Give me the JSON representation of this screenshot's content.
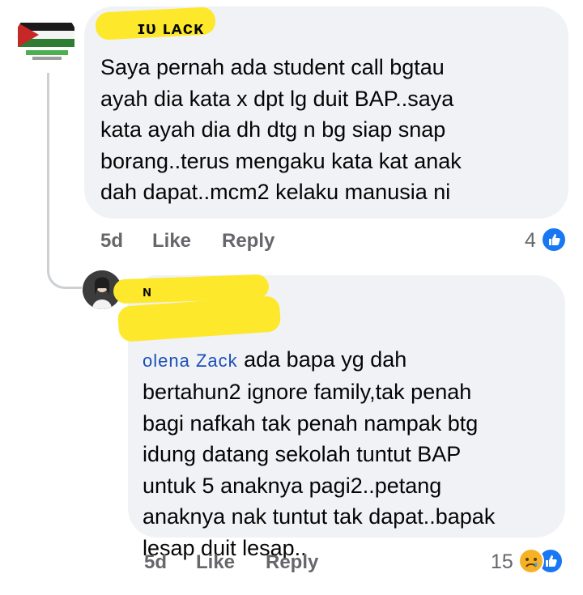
{
  "comment": {
    "author_partial": "ɪᴜ ʟᴀᴄᴋ",
    "text": "Saya pernah ada student call bgtau\nayah dia kata x dpt lg duit BAP..saya\nkata ayah dia dh dtg n bg siap snap\nborang..terus mengaku kata kat anak\ndah dapat..mcm2 kelaku manusia ni",
    "time": "5d",
    "like_label": "Like",
    "reply_label": "Reply",
    "reaction_count": "4",
    "reaction_icon": "like-icon",
    "like_color": "#1877f2"
  },
  "reply": {
    "author_partial": "ɴ",
    "mention_partial": "olena Zack",
    "text_first": " ada bapa yg dah",
    "text_rest": "bertahun2 ignore family,tak penah\nbagi nafkah tak penah nampak btg\nidung datang sekolah tuntut BAP\nuntuk 5 anaknya pagi2..petang\nanaknya nak tuntut tak dapat..bapak\nlesap duit lesap..",
    "time": "5d",
    "like_label": "Like",
    "reply_label": "Reply",
    "reaction_count": "15",
    "reaction_icons": [
      "sad-icon",
      "like-icon"
    ],
    "sad_color": "#f7b125"
  }
}
